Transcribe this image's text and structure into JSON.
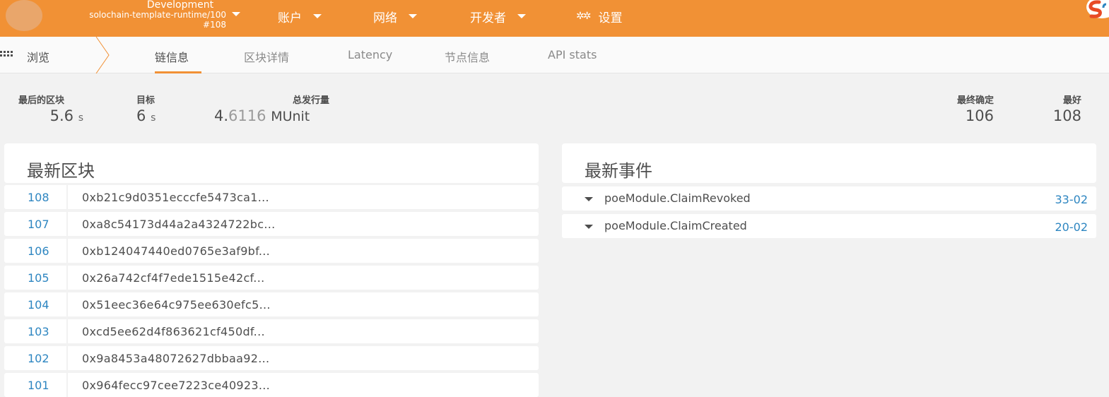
{
  "topbar": {
    "chain_name": "Development",
    "runtime": "solochain-template-runtime/100",
    "block": "#108",
    "menu": [
      {
        "label": "账户"
      },
      {
        "label": "网络"
      },
      {
        "label": "开发者"
      },
      {
        "label": "设置"
      }
    ],
    "bar_color": "#f19135"
  },
  "subnav": {
    "browse_label": "浏览",
    "tabs": [
      {
        "label": "链信息",
        "active": true
      },
      {
        "label": "区块详情"
      },
      {
        "label": "Latency"
      },
      {
        "label": "节点信息"
      },
      {
        "label": "API stats"
      }
    ]
  },
  "summary": {
    "last_block": {
      "label": "最后的区块",
      "value": "5.6",
      "unit": "s"
    },
    "target": {
      "label": "目标",
      "value": "6",
      "unit": "s"
    },
    "issuance": {
      "label": "总发行量",
      "int": "4.",
      "frac": "6116",
      "unit": "MUnit"
    },
    "finalized": {
      "label": "最终确定",
      "value": "106"
    },
    "best": {
      "label": "最好",
      "value": "108"
    }
  },
  "recent_blocks": {
    "title": "最新区块",
    "rows": [
      {
        "number": "108",
        "hash": "0xb21c9d0351ecccfe5473ca1..."
      },
      {
        "number": "107",
        "hash": "0xa8c54173d44a2a4324722bc..."
      },
      {
        "number": "106",
        "hash": "0xb124047440ed0765e3af9bf..."
      },
      {
        "number": "105",
        "hash": "0x26a742cf4f7ede1515e42cf..."
      },
      {
        "number": "104",
        "hash": "0x51eec36e64c975ee630efc5..."
      },
      {
        "number": "103",
        "hash": "0xcd5ee62d4f863621cf450df..."
      },
      {
        "number": "102",
        "hash": "0x9a8453a48072627dbbaa92..."
      },
      {
        "number": "101",
        "hash": "0x964fecc97cee7223ce40923..."
      }
    ]
  },
  "recent_events": {
    "title": "最新事件",
    "rows": [
      {
        "name": "poeModule.ClaimRevoked",
        "ref": "33-02"
      },
      {
        "name": "poeModule.ClaimCreated",
        "ref": "20-02"
      }
    ]
  },
  "colors": {
    "accent": "#f19135",
    "link": "#2e86c1"
  }
}
